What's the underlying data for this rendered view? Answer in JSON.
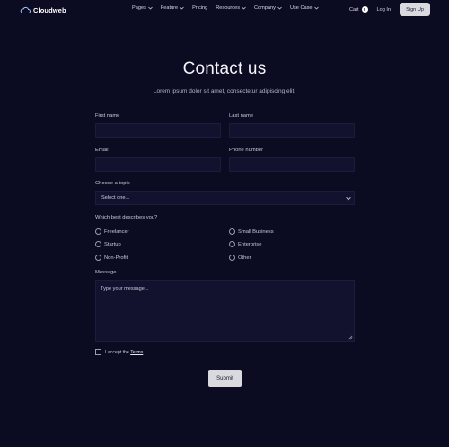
{
  "nav": {
    "logo_text": "Cloudweb",
    "menu": [
      {
        "label": "Pages",
        "dropdown": true
      },
      {
        "label": "Feature",
        "dropdown": true
      },
      {
        "label": "Pricing",
        "dropdown": false
      },
      {
        "label": "Resources",
        "dropdown": true
      },
      {
        "label": "Company",
        "dropdown": true
      },
      {
        "label": "Use Case",
        "dropdown": true
      }
    ],
    "cart_label": "Cart",
    "cart_count": "0",
    "login_label": "Log In",
    "signup_label": "Sign Up"
  },
  "header": {
    "title": "Contact us",
    "subtitle": "Lorem ipsum dolor sit amet, consectetur adipiscing elit."
  },
  "form": {
    "first_name_label": "First name",
    "last_name_label": "Last name",
    "email_label": "Email",
    "phone_label": "Phone number",
    "topic_label": "Choose a topic",
    "topic_value": "Select one...",
    "describe_label": "Which best describes you?",
    "options": [
      "Freelancer",
      "Small Business",
      "Startup",
      "Enterprise",
      "Non-Profit",
      "Other"
    ],
    "message_label": "Message",
    "message_placeholder": "Type your message...",
    "terms_prefix": "I accept the",
    "terms_link": "Terms",
    "submit_label": "Submit"
  },
  "colors": {
    "background": "#0b0b22",
    "field_bg": "#12122e",
    "button_bg": "#d9d9de"
  }
}
